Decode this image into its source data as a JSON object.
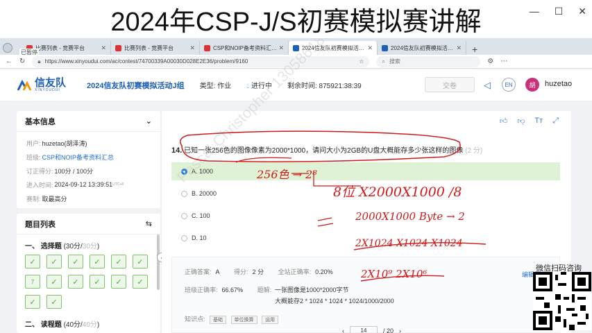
{
  "video_title": "2024年CSP-J/S初赛模拟赛讲解",
  "window_controls": [
    "—",
    "☐",
    "✕"
  ],
  "browser": {
    "profile_label": "已暂停",
    "tabs": [
      {
        "title": "比赛列表 - 竞赛平台",
        "active": false
      },
      {
        "title": "比赛列表 - 竞赛平台",
        "active": false
      },
      {
        "title": "CSP和NOIP备考资料汇总 - 信友",
        "active": false
      },
      {
        "title": "2024信友队初赛模拟活动组 - ",
        "active": true
      },
      {
        "title": "2024信友队初赛模拟活动组 - ",
        "active": false
      }
    ],
    "url": "https://www.xinyoudui.com/ac/contest/74700339A00030D028E2E36/problem/9160",
    "search_placeholder": "搜索"
  },
  "header": {
    "logo_cn": "信友队",
    "logo_en": "XINYOUDUI",
    "contest_name": "2024信友队初赛模拟活动J组",
    "type_label": "类型:",
    "type_value": "作业",
    "status": "进行中",
    "remaining_label": "剩余时间:",
    "remaining_value": "875921:38:39",
    "submit_label": "交卷",
    "lang": "EN",
    "avatar_char": "胡",
    "username": "huzetao"
  },
  "basic_info": {
    "title": "基本信息",
    "rows": [
      {
        "label": "用户:",
        "value": "huzetao(胡泽涛)"
      },
      {
        "label": "班级:",
        "value": "CSP和NOIP备考资料汇总",
        "link": true
      },
      {
        "label": "订正得分:",
        "value": "100分 / 100分"
      },
      {
        "label": "进入时间:",
        "value": "2024-09-12 13:39:51",
        "sup": "UTC+8"
      },
      {
        "label": "赛制:",
        "value": "取最高分"
      }
    ]
  },
  "question_list": {
    "title": "题目列表",
    "sections": [
      {
        "name": "一、 选择题",
        "score": "(30分/",
        "score_em": "30分",
        "score_end": ")",
        "cells": [
          "✓",
          "✓",
          "✓",
          "✓",
          "✓",
          "✓",
          "7",
          "✓",
          "✓",
          "✓",
          "✓",
          "✓",
          "✓",
          "✓"
        ]
      },
      {
        "name": "二、 读程题",
        "score": "(40分/",
        "score_em": "40分",
        "score_end": ")"
      }
    ]
  },
  "question": {
    "number": "14.",
    "text": "已知一张256色的图像像素为2000*1000，请问大小为2GB的U盘大概能存多少张这样的图像",
    "points": "(2 分)",
    "options": [
      {
        "label": "A.",
        "value": "1000",
        "selected": true
      },
      {
        "label": "B.",
        "value": "20000",
        "selected": false
      },
      {
        "label": "C.",
        "value": "100",
        "selected": false
      },
      {
        "label": "D.",
        "value": "10",
        "selected": false
      }
    ]
  },
  "answer": {
    "correct_label": "正确答案:",
    "correct_value": "A",
    "score_label": "得分:",
    "score_value": "2 分",
    "site_rate_label": "全站正确率:",
    "site_rate_value": "0.20%",
    "class_rate_label": "班级正确率:",
    "class_rate_value": "66.67%",
    "explain_label": "题解:",
    "explain_line1": "一张图像是1000*2000字节",
    "explain_line2": "大概能存2 * 1024 * 1024 * 1024/1000/2000",
    "knowledge_label": "知识点:",
    "tags": [
      "基础",
      "单位换算",
      "运用"
    ],
    "edit_label": "编辑题目"
  },
  "pager": {
    "current": "14",
    "total": "/ 20"
  },
  "watermark": "Pascal Christopher 13058618683",
  "annotations": {
    "a1": "256色 → 2⁸",
    "a2": "8位 X2000X1000 /8",
    "a3": "2000X1000 Byte → 2",
    "a4": "2X1024 X1024 X1024",
    "a5": "2X10⁹ 2X10⁶"
  },
  "qr_label": "微信扫码咨询",
  "colors": {
    "brand": "#1e5fb8",
    "accent": "#2b7be4",
    "success": "#7fc46a",
    "ink": "#d21919"
  }
}
